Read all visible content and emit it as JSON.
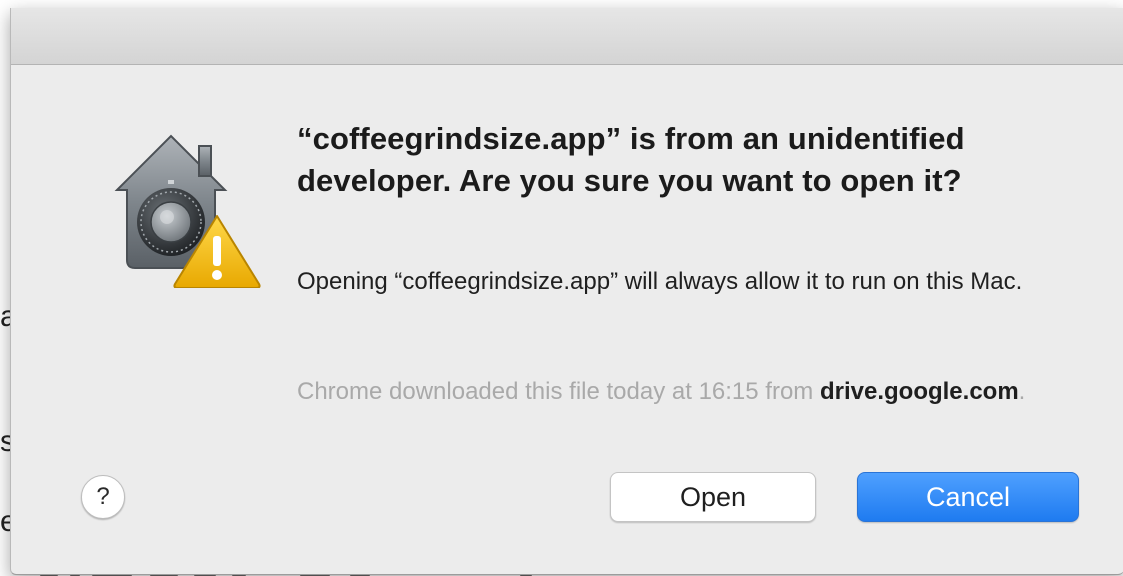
{
  "dialog": {
    "title": "“coffeegrindsize.app” is from an unidentified developer. Are you sure you want to open it?",
    "message": "Opening “coffeegrindsize.app” will always allow it to run on this Mac.",
    "source_prefix": "Chrome downloaded this file today at 16:15 from ",
    "source_domain": "drive.google.com",
    "source_suffix": ".",
    "icon": "gatekeeper-security-warning-icon"
  },
  "buttons": {
    "help_label": "?",
    "open_label": "Open",
    "cancel_label": "Cancel"
  },
  "background_window": {
    "edge_glyphs": [
      "a",
      "s",
      "e"
    ]
  },
  "colors": {
    "dialog_background": "#ececec",
    "primary_button": "#1f7bf0",
    "secondary_text": "#a9a9a9",
    "warning_yellow": "#f5c518"
  }
}
